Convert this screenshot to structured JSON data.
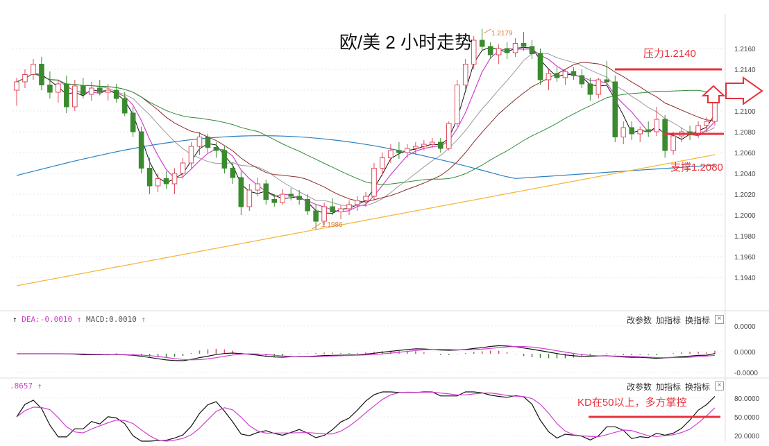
{
  "chart_data": {
    "type": "candlestick",
    "title": "欧/美 2 小时走势",
    "ylim": [
      1.192,
      1.218
    ],
    "y_ticks": [
      "1.2160",
      "1.2140",
      "1.2120",
      "1.2100",
      "1.2080",
      "1.2060",
      "1.2040",
      "1.2020",
      "1.2000",
      "1.1980",
      "1.1960",
      "1.1940"
    ],
    "annotations": {
      "resistance_label": "压力1.2140",
      "resistance_value": 1.214,
      "support_label": "支撑1.2080",
      "support_value": 1.2078,
      "high_label": "1.2179",
      "low_label": "1.1986"
    },
    "candles_ohlc": [
      [
        1.212,
        1.2132,
        1.2105,
        1.2128
      ],
      [
        1.2128,
        1.214,
        1.2122,
        1.2135
      ],
      [
        1.2135,
        1.215,
        1.213,
        1.2145
      ],
      [
        1.2145,
        1.2152,
        1.212,
        1.2125
      ],
      [
        1.2125,
        1.2138,
        1.2112,
        1.2118
      ],
      [
        1.2118,
        1.213,
        1.2108,
        1.2126
      ],
      [
        1.2126,
        1.2134,
        1.2098,
        1.2104
      ],
      [
        1.2104,
        1.213,
        1.21,
        1.2124
      ],
      [
        1.2124,
        1.2132,
        1.2112,
        1.2116
      ],
      [
        1.2116,
        1.2128,
        1.211,
        1.2122
      ],
      [
        1.2122,
        1.213,
        1.2115,
        1.2118
      ],
      [
        1.2118,
        1.2126,
        1.211,
        1.212
      ],
      [
        1.212,
        1.2126,
        1.2108,
        1.2112
      ],
      [
        1.2112,
        1.2118,
        1.2095,
        1.2098
      ],
      [
        1.2098,
        1.2104,
        1.2075,
        1.208
      ],
      [
        1.208,
        1.2085,
        1.204,
        1.2045
      ],
      [
        1.2045,
        1.2055,
        1.202,
        1.2028
      ],
      [
        1.2028,
        1.204,
        1.2022,
        1.2035
      ],
      [
        1.2035,
        1.2042,
        1.2025,
        1.203
      ],
      [
        1.203,
        1.2045,
        1.202,
        1.204
      ],
      [
        1.204,
        1.2055,
        1.2035,
        1.205
      ],
      [
        1.205,
        1.207,
        1.2045,
        1.2066
      ],
      [
        1.2066,
        1.208,
        1.2058,
        1.2075
      ],
      [
        1.2075,
        1.2078,
        1.206,
        1.2065
      ],
      [
        1.2065,
        1.207,
        1.2055,
        1.2062
      ],
      [
        1.2062,
        1.2066,
        1.204,
        1.2045
      ],
      [
        1.2045,
        1.205,
        1.203,
        1.2036
      ],
      [
        1.2036,
        1.2042,
        1.2,
        1.2008
      ],
      [
        1.2008,
        1.203,
        1.2004,
        1.2024
      ],
      [
        1.2024,
        1.2036,
        1.2018,
        1.203
      ],
      [
        1.203,
        1.2034,
        1.201,
        1.2015
      ],
      [
        1.2015,
        1.202,
        1.2008,
        1.2012
      ],
      [
        1.2012,
        1.2025,
        1.201,
        1.202
      ],
      [
        1.202,
        1.2026,
        1.2014,
        1.2018
      ],
      [
        1.2018,
        1.2024,
        1.201,
        1.2015
      ],
      [
        1.2015,
        1.202,
        1.2,
        1.2004
      ],
      [
        1.2004,
        1.201,
        1.1986,
        1.1994
      ],
      [
        1.1994,
        1.2012,
        1.199,
        1.2008
      ],
      [
        1.2008,
        1.2016,
        1.2,
        1.2003
      ],
      [
        1.2003,
        1.201,
        1.1996,
        1.2006
      ],
      [
        1.2006,
        1.2014,
        1.2,
        1.201
      ],
      [
        1.201,
        1.2018,
        1.2004,
        1.2014
      ],
      [
        1.2014,
        1.2022,
        1.2008,
        1.2018
      ],
      [
        1.2018,
        1.205,
        1.2014,
        1.2045
      ],
      [
        1.2045,
        1.206,
        1.2038,
        1.2055
      ],
      [
        1.2055,
        1.2068,
        1.205,
        1.2062
      ],
      [
        1.2062,
        1.207,
        1.2054,
        1.206
      ],
      [
        1.206,
        1.2068,
        1.2055,
        1.2064
      ],
      [
        1.2064,
        1.207,
        1.2058,
        1.2066
      ],
      [
        1.2066,
        1.2072,
        1.2062,
        1.2068
      ],
      [
        1.2068,
        1.2074,
        1.2064,
        1.207
      ],
      [
        1.207,
        1.2074,
        1.206,
        1.2064
      ],
      [
        1.2064,
        1.209,
        1.2062,
        1.2088
      ],
      [
        1.2088,
        1.213,
        1.2085,
        1.2125
      ],
      [
        1.2125,
        1.215,
        1.212,
        1.2145
      ],
      [
        1.2145,
        1.2172,
        1.214,
        1.2168
      ],
      [
        1.2168,
        1.2179,
        1.2158,
        1.2162
      ],
      [
        1.2162,
        1.2166,
        1.215,
        1.2154
      ],
      [
        1.2154,
        1.2164,
        1.2145,
        1.216
      ],
      [
        1.216,
        1.2166,
        1.215,
        1.2156
      ],
      [
        1.2156,
        1.217,
        1.2152,
        1.2165
      ],
      [
        1.2165,
        1.2176,
        1.2158,
        1.2162
      ],
      [
        1.2162,
        1.2168,
        1.215,
        1.2155
      ],
      [
        1.2155,
        1.216,
        1.2125,
        1.213
      ],
      [
        1.213,
        1.214,
        1.212,
        1.2136
      ],
      [
        1.2136,
        1.2142,
        1.2128,
        1.2132
      ],
      [
        1.2132,
        1.214,
        1.2125,
        1.2138
      ],
      [
        1.2138,
        1.2142,
        1.213,
        1.2134
      ],
      [
        1.2134,
        1.214,
        1.2122,
        1.2126
      ],
      [
        1.2126,
        1.2132,
        1.211,
        1.2116
      ],
      [
        1.2116,
        1.2132,
        1.2112,
        1.213
      ],
      [
        1.213,
        1.2148,
        1.2124,
        1.2128
      ],
      [
        1.2128,
        1.2134,
        1.207,
        1.2075
      ],
      [
        1.2075,
        1.209,
        1.2068,
        1.2084
      ],
      [
        1.2084,
        1.209,
        1.2072,
        1.2078
      ],
      [
        1.2078,
        1.2085,
        1.207,
        1.2082
      ],
      [
        1.2082,
        1.209,
        1.2075,
        1.208
      ],
      [
        1.208,
        1.2104,
        1.2076,
        1.2092
      ],
      [
        1.2092,
        1.2096,
        1.2055,
        1.2062
      ],
      [
        1.2062,
        1.208,
        1.2058,
        1.2076
      ],
      [
        1.2076,
        1.2084,
        1.207,
        1.208
      ],
      [
        1.208,
        1.2086,
        1.2072,
        1.2077
      ],
      [
        1.2077,
        1.209,
        1.2074,
        1.2086
      ],
      [
        1.2086,
        1.2094,
        1.208,
        1.209
      ],
      [
        1.209,
        1.212,
        1.2086,
        1.2115
      ]
    ],
    "ma_levels": [
      1.21,
      1.208,
      1.206,
      1.204,
      1.203,
      1.212
    ],
    "macd_labels": {
      "dea": "DEA:-0.0010",
      "macd": "MACD:0.0010"
    },
    "macd_ticks": [
      "0.0000",
      "0.0000",
      "-0.0000"
    ],
    "kd_label": ".8657",
    "kd_ticks": [
      "80.0000",
      "50.0000",
      "20.0000"
    ],
    "kd_annotation": "KD在50以上，多方掌控",
    "kd_level": 50
  },
  "controls": {
    "params": "改参数",
    "add_indicator": "加指标",
    "switch_indicator": "换指标",
    "close": "×"
  },
  "colors": {
    "up": "#e0495a",
    "down": "#3a8a2e",
    "annotation": "#e8303a",
    "ma_black": "#111111",
    "ma_magenta": "#d13fd1",
    "ma_gray": "#9a9a9a",
    "ma_darkred": "#8b2b2b",
    "ma_green": "#2f8a3a",
    "ma_blue": "#2a7fc0",
    "ma_orange": "#f2b430"
  }
}
